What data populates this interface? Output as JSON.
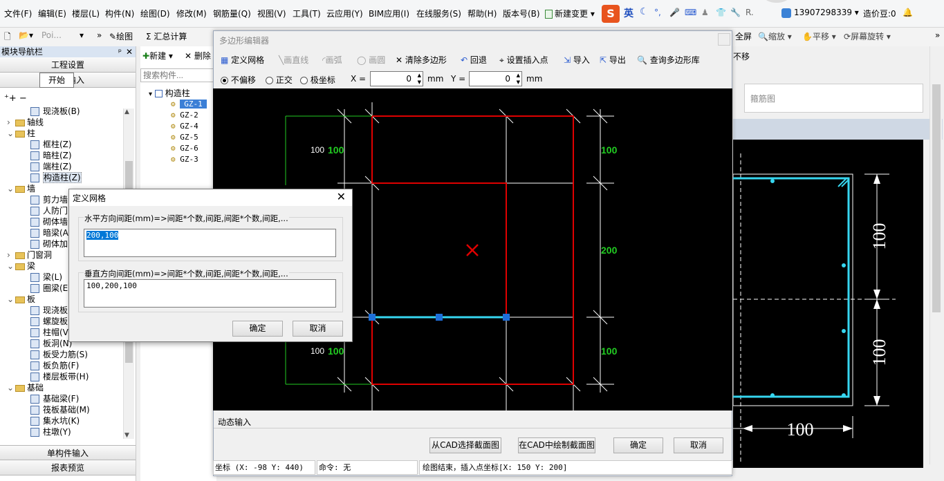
{
  "menu": {
    "file": "文件(F)",
    "edit": "编辑(E)",
    "floor": "楼层(L)",
    "component": "构件(N)",
    "draw": "绘图(D)",
    "modify": "修改(M)",
    "rebar": "钢筋量(Q)",
    "view": "视图(V)",
    "tools": "工具(T)",
    "cloud": "云应用(Y)",
    "bim": "BIM应用(I)",
    "online": "在线服务(S)",
    "help": "帮助(H)",
    "version": "版本号(B)",
    "new_change": "新建变更",
    "ime": "英",
    "phone": "13907298339",
    "bean": "造价豆:0"
  },
  "toolbar": {
    "poi": "Poi...",
    "draw": "绘图",
    "sum": "Σ 汇总计算",
    "fullscreen": "全屏",
    "zoom": "缩放",
    "pan": "平移",
    "rotate": "屏幕旋转",
    "start_tooltip": "开始",
    "offset": "不移"
  },
  "left_panel": {
    "title": "模块导航栏",
    "project_settings": "工程设置",
    "drawing_input": "绘图输入",
    "single_input": "单构件输入",
    "report": "报表预览",
    "tree": [
      {
        "label": "现浇板(B)",
        "indent": 2
      },
      {
        "label": "轴线",
        "indent": 1,
        "folder": true
      },
      {
        "label": "柱",
        "indent": 1,
        "folder": true
      },
      {
        "label": "框柱(Z)",
        "indent": 2
      },
      {
        "label": "暗柱(Z)",
        "indent": 2
      },
      {
        "label": "端柱(Z)",
        "indent": 2
      },
      {
        "label": "构造柱(Z)",
        "indent": 2,
        "selected": true
      },
      {
        "label": "墙",
        "indent": 1,
        "folder": true
      },
      {
        "label": "剪力墙",
        "indent": 2
      },
      {
        "label": "人防门",
        "indent": 2
      },
      {
        "label": "砌体墙",
        "indent": 2
      },
      {
        "label": "暗梁(A",
        "indent": 2
      },
      {
        "label": "砌体加",
        "indent": 2
      },
      {
        "label": "门窗洞",
        "indent": 1,
        "folder": true
      },
      {
        "label": "梁",
        "indent": 1,
        "folder": true
      },
      {
        "label": "梁(L)",
        "indent": 2
      },
      {
        "label": "圈梁(E",
        "indent": 2
      },
      {
        "label": "板",
        "indent": 1,
        "folder": true
      },
      {
        "label": "现浇板",
        "indent": 2
      },
      {
        "label": "螺旋板",
        "indent": 2
      },
      {
        "label": "柱帽(V",
        "indent": 2
      },
      {
        "label": "板洞(N)",
        "indent": 2
      },
      {
        "label": "板受力筋(S)",
        "indent": 2
      },
      {
        "label": "板负筋(F)",
        "indent": 2
      },
      {
        "label": "楼层板带(H)",
        "indent": 2
      },
      {
        "label": "基础",
        "indent": 1,
        "folder": true
      },
      {
        "label": "基础梁(F)",
        "indent": 2
      },
      {
        "label": "筏板基础(M)",
        "indent": 2
      },
      {
        "label": "集水坑(K)",
        "indent": 2
      },
      {
        "label": "柱墩(Y)",
        "indent": 2
      }
    ]
  },
  "component_list": {
    "new": "新建",
    "delete": "删除",
    "search_placeholder": "搜索构件...",
    "root": "构造柱",
    "items": [
      "GZ-1",
      "GZ-2",
      "GZ-4",
      "GZ-5",
      "GZ-6",
      "GZ-3"
    ]
  },
  "editor": {
    "title": "多边形编辑器",
    "tools": {
      "define_grid": "定义网格",
      "line": "画直线",
      "arc": "画弧",
      "circle": "画圆",
      "clear": "清除多边形",
      "undo": "回退",
      "insert_point": "设置插入点",
      "import": "导入",
      "export": "导出",
      "query": "查询多边形库"
    },
    "mode_none": "不偏移",
    "mode_ortho": "正交",
    "mode_polar": "极坐标",
    "x_label": "X =",
    "x_value": "0",
    "y_label": "Y =",
    "y_value": "0",
    "unit": "mm",
    "dyn_input": "动态输入",
    "btn_cad_select": "从CAD选择截面图",
    "btn_cad_draw": "在CAD中绘制截面图",
    "btn_ok": "确定",
    "btn_cancel": "取消",
    "status_coord": "坐标 (X: -98 Y: 440)",
    "status_cmd": "命令: 无",
    "status_msg": "绘图结束，插入点坐标[X: 150 Y: 200]",
    "dims": {
      "left_top_white": "100",
      "left_top_green": "100",
      "left_bottom_white": "100",
      "left_bottom_green": "100",
      "right_top": "100",
      "right_mid": "200",
      "right_bottom": "100"
    }
  },
  "grid_dialog": {
    "title": "定义网格",
    "h_label": "水平方向间距(mm)=>间距*个数,间距,间距*个数,间距,...",
    "h_value": "200,100",
    "v_label": "垂直方向间距(mm)=>间距*个数,间距,间距*个数,间距,...",
    "v_value": "100,200,100",
    "ok": "确定",
    "cancel": "取消"
  },
  "right_panel": {
    "title": "箍筋图",
    "dim_v1": "100",
    "dim_v2": "100",
    "dim_h": "100"
  },
  "colors": {
    "red": "#e00000",
    "cyan": "#36d6f0",
    "green": "#22cc22",
    "blue_handle": "#1e6fd9"
  }
}
